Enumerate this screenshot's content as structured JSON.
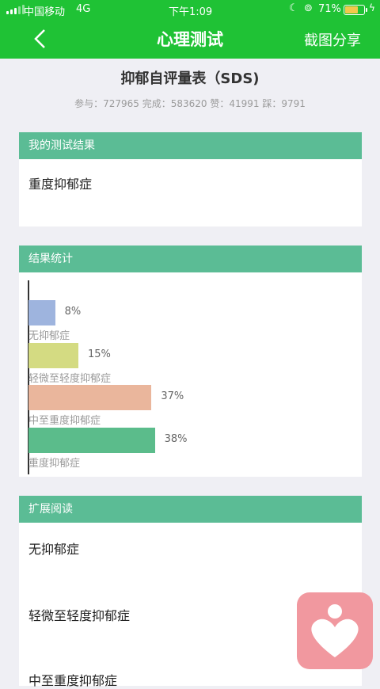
{
  "status_bar": {
    "carrier": "中国移动",
    "network": "4G",
    "time": "下午1:09",
    "battery_percent": "71%",
    "battery_level": 0.71,
    "icons": [
      "signal-icon",
      "moon-icon",
      "rotation-lock-icon",
      "battery-icon",
      "charging-icon"
    ]
  },
  "nav": {
    "title": "心理测试",
    "share_label": "截图分享",
    "back_icon": "chevron-left-icon"
  },
  "test": {
    "title": "抑郁自评量表（SDS)",
    "stats": "参与：727965 完成：583620 赞：41991 踩：9791"
  },
  "my_result": {
    "header": "我的测试结果",
    "text": "重度抑郁症"
  },
  "result_stats": {
    "header": "结果统计"
  },
  "chart_data": {
    "type": "bar",
    "orientation": "horizontal",
    "categories": [
      "无抑郁症",
      "轻微至轻度抑郁症",
      "中至重度抑郁症",
      "重度抑郁症"
    ],
    "values": [
      8,
      15,
      37,
      38
    ],
    "value_labels": [
      "8%",
      "15%",
      "37%",
      "38%"
    ],
    "colors": [
      "#9eb4de",
      "#d4db82",
      "#eab69c",
      "#5bbc8b"
    ],
    "title": "",
    "xlabel": "",
    "ylabel": ""
  },
  "extended_reading": {
    "header": "扩展阅读",
    "items": [
      "无抑郁症",
      "轻微至轻度抑郁症",
      "中至重度抑郁症"
    ]
  },
  "colors": {
    "nav_green": "#1fc235",
    "card_header_green": "#5bbc95",
    "fab_pink": "#f1989f"
  },
  "fab": {
    "icon": "heart-person-icon"
  }
}
